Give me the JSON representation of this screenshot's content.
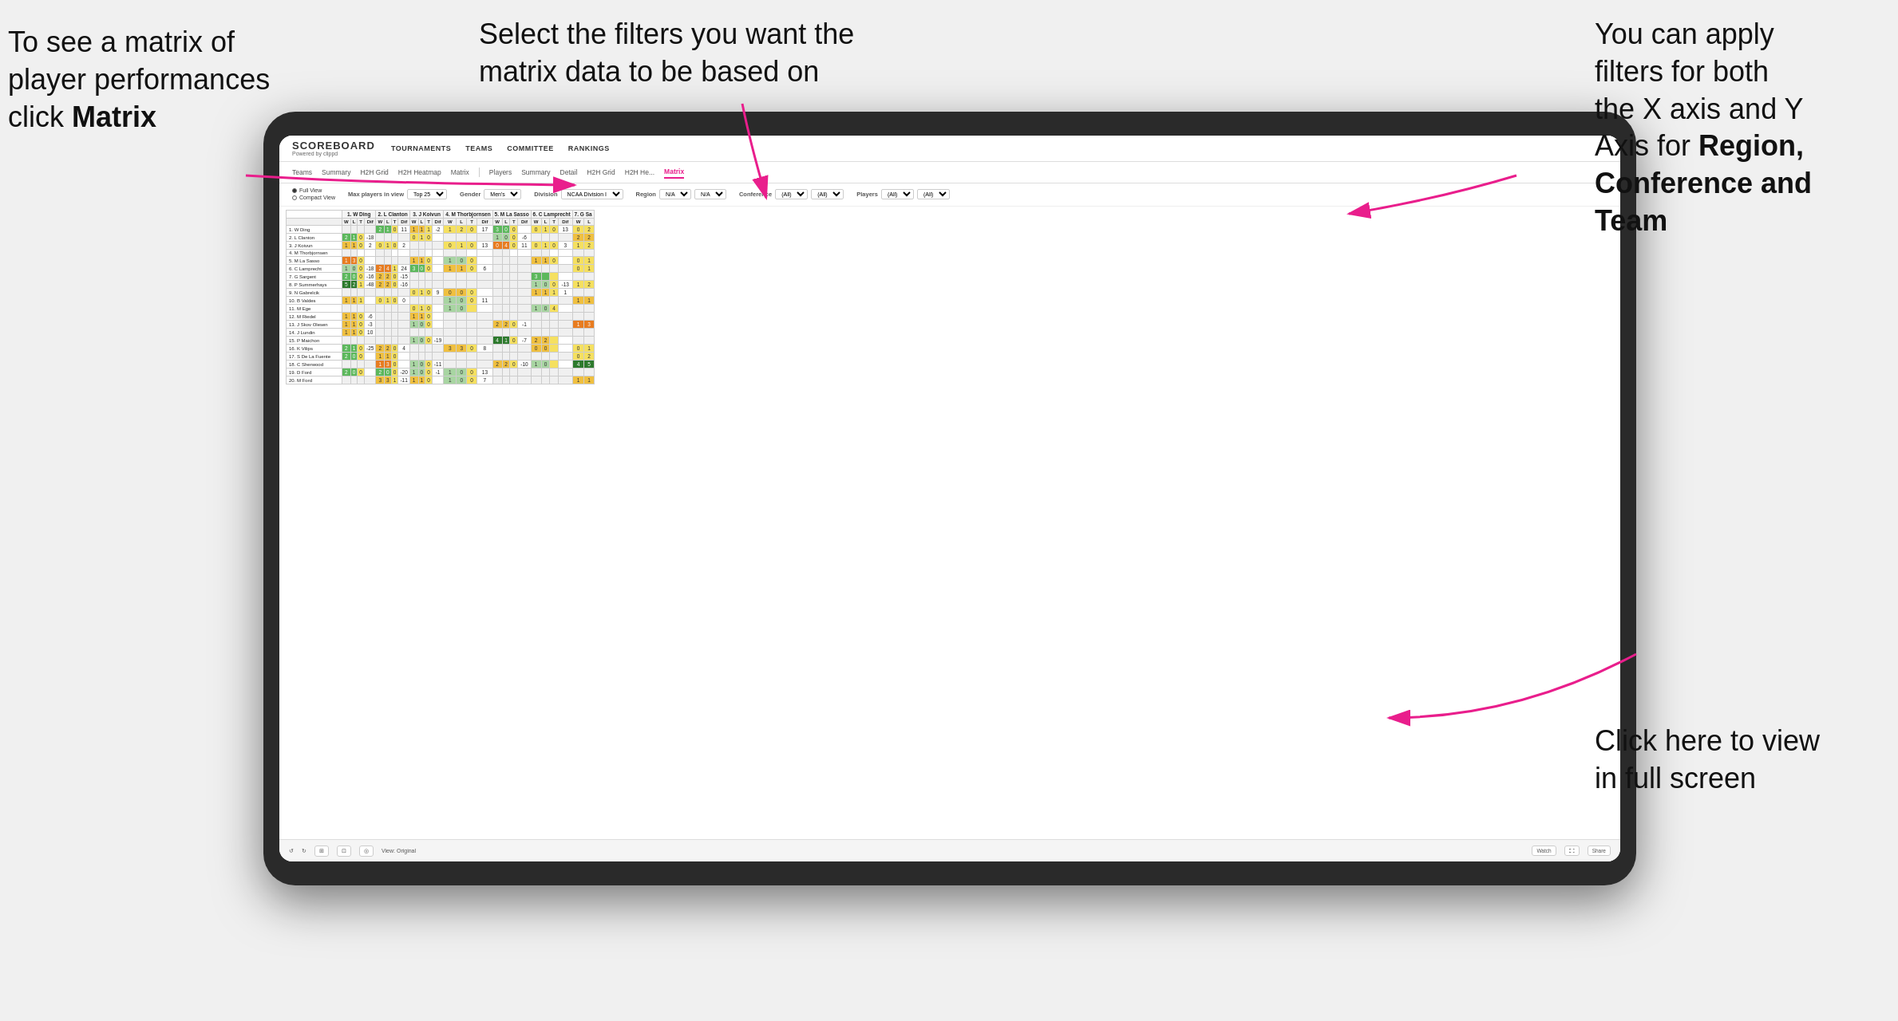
{
  "annotations": {
    "top_left": {
      "line1": "To see a matrix of",
      "line2": "player performances",
      "line3_prefix": "click ",
      "line3_bold": "Matrix"
    },
    "top_center": {
      "text": "Select the filters you want the matrix data to be based on"
    },
    "top_right": {
      "line1": "You  can apply",
      "line2": "filters for both",
      "line3": "the X axis and Y",
      "line4_prefix": "Axis for ",
      "line4_bold": "Region,",
      "line5_bold": "Conference and",
      "line6_bold": "Team"
    },
    "bottom_right": {
      "line1": "Click here to view",
      "line2": "in full screen"
    }
  },
  "nav": {
    "logo_main": "SCOREBOARD",
    "logo_sub": "Powered by clippd",
    "items": [
      "TOURNAMENTS",
      "TEAMS",
      "COMMITTEE",
      "RANKINGS"
    ]
  },
  "sub_nav": {
    "tabs": [
      "Teams",
      "Summary",
      "H2H Grid",
      "H2H Heatmap",
      "Matrix",
      "Players",
      "Summary",
      "Detail",
      "H2H Grid",
      "H2H He...",
      "Matrix"
    ]
  },
  "filters": {
    "view_full": "Full View",
    "view_compact": "Compact View",
    "max_players_label": "Max players in view",
    "max_players_value": "Top 25",
    "gender_label": "Gender",
    "gender_value": "Men's",
    "division_label": "Division",
    "division_value": "NCAA Division I",
    "region_label": "Region",
    "region_value1": "N/A",
    "region_value2": "N/A",
    "conference_label": "Conference",
    "conference_value1": "(All)",
    "conference_value2": "(All)",
    "players_label": "Players",
    "players_value1": "(All)",
    "players_value2": "(All)"
  },
  "matrix": {
    "col_headers": [
      "1. W Ding",
      "2. L Clanton",
      "3. J Koivun",
      "4. M Thorbjornsen",
      "5. M La Sasso",
      "6. C Lamprecht",
      "7. G Sa"
    ],
    "sub_headers": [
      "W",
      "L",
      "T",
      "Dif"
    ],
    "rows": [
      {
        "name": "1. W Ding",
        "cells": [
          [],
          [
            2,
            1,
            0,
            "11"
          ],
          [
            1,
            1,
            1,
            "-2"
          ],
          [
            1,
            2,
            0,
            "17"
          ],
          [
            3,
            0,
            0,
            ""
          ],
          [
            0,
            1,
            0,
            "13"
          ],
          [
            0,
            2,
            ""
          ]
        ]
      },
      {
        "name": "2. L Clanton",
        "cells": [
          [
            2,
            1,
            0,
            "-18"
          ],
          [],
          [
            0,
            1,
            0,
            ""
          ],
          [],
          [
            1,
            0,
            0,
            "-6"
          ],
          [],
          [
            2,
            2,
            ""
          ]
        ]
      },
      {
        "name": "3. J Koivun",
        "cells": [
          [
            1,
            1,
            0,
            "2"
          ],
          [
            0,
            1,
            0,
            "2"
          ],
          [],
          [
            0,
            1,
            0,
            "13"
          ],
          [
            0,
            4,
            0,
            "11"
          ],
          [
            0,
            1,
            0,
            "3"
          ],
          [
            1,
            2,
            ""
          ]
        ]
      },
      {
        "name": "4. M Thorbjornsen",
        "cells": [
          [
            "",
            "",
            "",
            ""
          ],
          [
            "",
            "",
            "",
            ""
          ],
          [
            "",
            "",
            "",
            ""
          ],
          [
            "",
            "",
            "",
            ""
          ],
          [
            "",
            "",
            "",
            ""
          ],
          [
            "",
            "",
            "",
            ""
          ],
          [
            "",
            "",
            ""
          ]
        ]
      },
      {
        "name": "5. M La Sasso",
        "cells": [
          [
            1,
            3,
            0,
            ""
          ],
          [],
          [
            1,
            1,
            0,
            ""
          ],
          [
            1,
            0,
            0,
            ""
          ],
          [],
          [
            1,
            1,
            0,
            ""
          ],
          [
            0,
            1,
            ""
          ]
        ]
      },
      {
        "name": "6. C Lamprecht",
        "cells": [
          [
            1,
            0,
            0,
            "-18"
          ],
          [
            2,
            4,
            1,
            "24"
          ],
          [
            3,
            0,
            0,
            ""
          ],
          [
            1,
            1,
            0,
            "6"
          ],
          [],
          [],
          [
            0,
            1,
            ""
          ]
        ]
      },
      {
        "name": "7. G Sargent",
        "cells": [
          [
            2,
            0,
            0,
            "-16"
          ],
          [
            2,
            2,
            0,
            "-15"
          ],
          [],
          [],
          [],
          [
            3,
            ""
          ],
          []
        ]
      },
      {
        "name": "8. P Summerhays",
        "cells": [
          [
            5,
            2,
            1,
            "-48"
          ],
          [
            2,
            2,
            0,
            "-16"
          ],
          [],
          [],
          [],
          [
            1,
            0,
            0,
            "-13"
          ],
          [
            1,
            2,
            ""
          ]
        ]
      },
      {
        "name": "9. N Gabrelcik",
        "cells": [
          [],
          [],
          [
            0,
            1,
            0,
            "9"
          ],
          [
            0,
            0,
            0,
            ""
          ],
          [],
          [
            1,
            1,
            1,
            "1"
          ],
          []
        ]
      },
      {
        "name": "10. B Valdes",
        "cells": [
          [
            1,
            1,
            1,
            ""
          ],
          [
            0,
            1,
            0,
            "0"
          ],
          [],
          [
            1,
            0,
            0,
            "11"
          ],
          [],
          [],
          [
            1,
            1,
            ""
          ]
        ]
      },
      {
        "name": "11. M Ege",
        "cells": [
          [],
          [],
          [
            0,
            1,
            0,
            ""
          ],
          [
            1,
            0,
            ""
          ],
          [],
          [
            1,
            0,
            4
          ],
          []
        ]
      },
      {
        "name": "12. M Riedel",
        "cells": [
          [
            1,
            1,
            0,
            "-6"
          ],
          [],
          [
            1,
            1,
            0,
            ""
          ],
          [],
          [],
          [],
          []
        ]
      },
      {
        "name": "13. J Skov Olesen",
        "cells": [
          [
            1,
            1,
            0,
            "-3"
          ],
          [],
          [
            1,
            0,
            0,
            ""
          ],
          [],
          [
            2,
            2,
            0,
            "-1"
          ],
          [],
          [
            1,
            3,
            ""
          ]
        ]
      },
      {
        "name": "14. J Lundin",
        "cells": [
          [
            1,
            1,
            0,
            "10"
          ],
          [],
          [],
          [],
          [],
          [],
          []
        ]
      },
      {
        "name": "15. P Maichon",
        "cells": [
          [],
          [],
          [
            1,
            0,
            0,
            "-19"
          ],
          [],
          [
            4,
            1,
            0,
            "-7"
          ],
          [
            2,
            2,
            ""
          ],
          []
        ]
      },
      {
        "name": "16. K Vilips",
        "cells": [
          [
            2,
            1,
            0,
            "-25"
          ],
          [
            2,
            2,
            0,
            "4"
          ],
          [],
          [
            3,
            3,
            0,
            "8"
          ],
          [],
          [
            0,
            0,
            ""
          ],
          [
            0,
            1,
            ""
          ]
        ]
      },
      {
        "name": "17. S De La Fuente",
        "cells": [
          [
            2,
            0,
            0,
            ""
          ],
          [
            1,
            1,
            0,
            ""
          ],
          [],
          [],
          [],
          [],
          [
            0,
            2,
            ""
          ]
        ]
      },
      {
        "name": "18. C Sherwood",
        "cells": [
          [],
          [
            1,
            3,
            0,
            ""
          ],
          [
            1,
            0,
            0,
            "-11"
          ],
          [],
          [
            2,
            2,
            0,
            "-10"
          ],
          [
            1,
            0,
            ""
          ],
          [
            4,
            5,
            ""
          ]
        ]
      },
      {
        "name": "19. D Ford",
        "cells": [
          [
            2,
            0,
            0,
            ""
          ],
          [
            2,
            0,
            0,
            "-20"
          ],
          [
            1,
            0,
            0,
            "-1"
          ],
          [
            1,
            0,
            0,
            "13"
          ],
          [],
          [],
          []
        ]
      },
      {
        "name": "20. M Ford",
        "cells": [
          [],
          [
            3,
            3,
            1,
            "-11"
          ],
          [
            1,
            1,
            0,
            ""
          ],
          [
            1,
            0,
            0,
            "7"
          ],
          [],
          [],
          [
            1,
            1,
            ""
          ]
        ]
      }
    ]
  },
  "footer": {
    "view_label": "View: Original",
    "watch_label": "Watch",
    "share_label": "Share"
  }
}
